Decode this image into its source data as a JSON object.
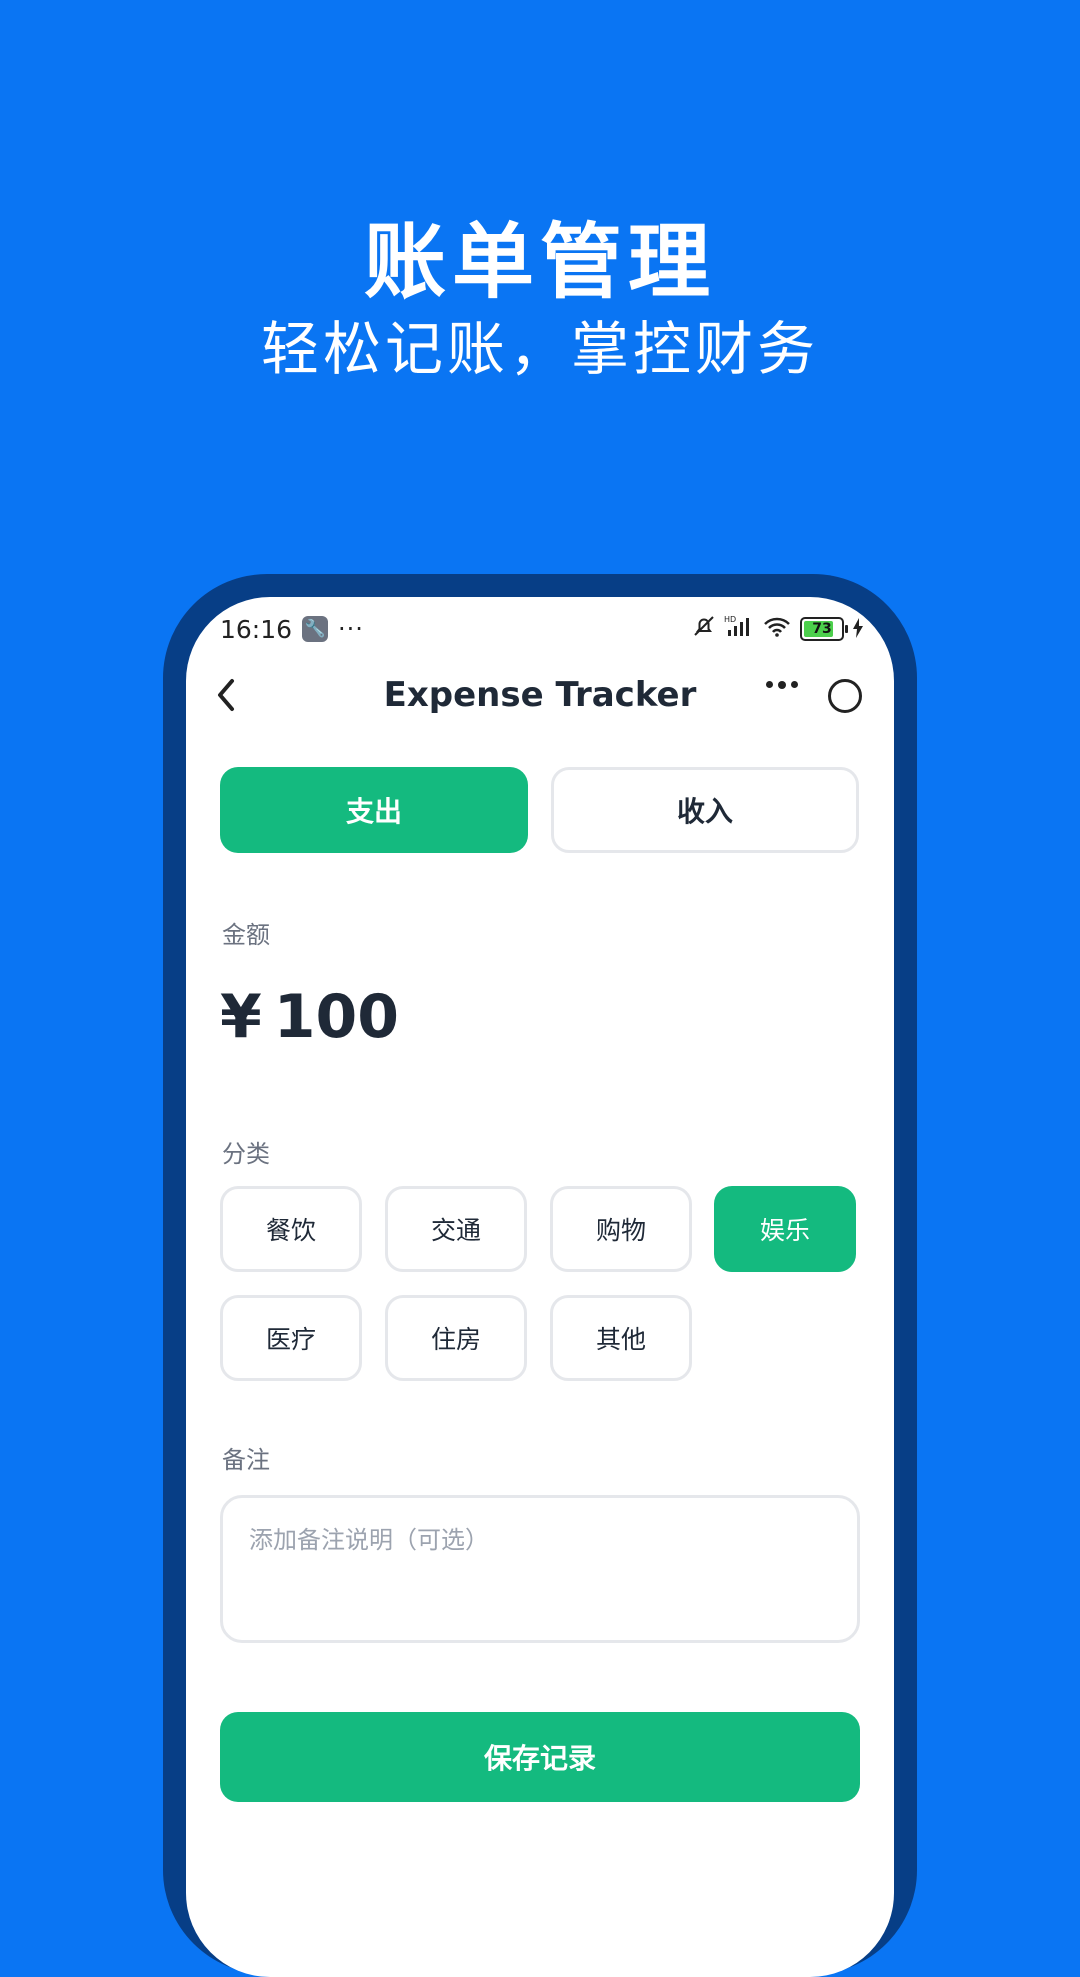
{
  "hero": {
    "title": "账单管理",
    "subtitle": "轻松记账，掌控财务"
  },
  "status_bar": {
    "time": "16:16",
    "more": "···",
    "network": "HD",
    "battery": "73"
  },
  "nav": {
    "back": "‹",
    "title": "Expense Tracker"
  },
  "type_toggle": {
    "expense": "支出",
    "income": "收入",
    "selected": "expense"
  },
  "amount": {
    "label": "金额",
    "currency": "¥",
    "value": "100"
  },
  "category": {
    "label": "分类",
    "items": [
      "餐饮",
      "交通",
      "购物",
      "娱乐",
      "医疗",
      "住房",
      "其他"
    ],
    "selected": "娱乐"
  },
  "note": {
    "label": "备注",
    "placeholder": "添加备注说明（可选）"
  },
  "save_button": "保存记录",
  "colors": {
    "background": "#0a75f3",
    "accent": "#14ba7f",
    "frame": "#073e86"
  }
}
